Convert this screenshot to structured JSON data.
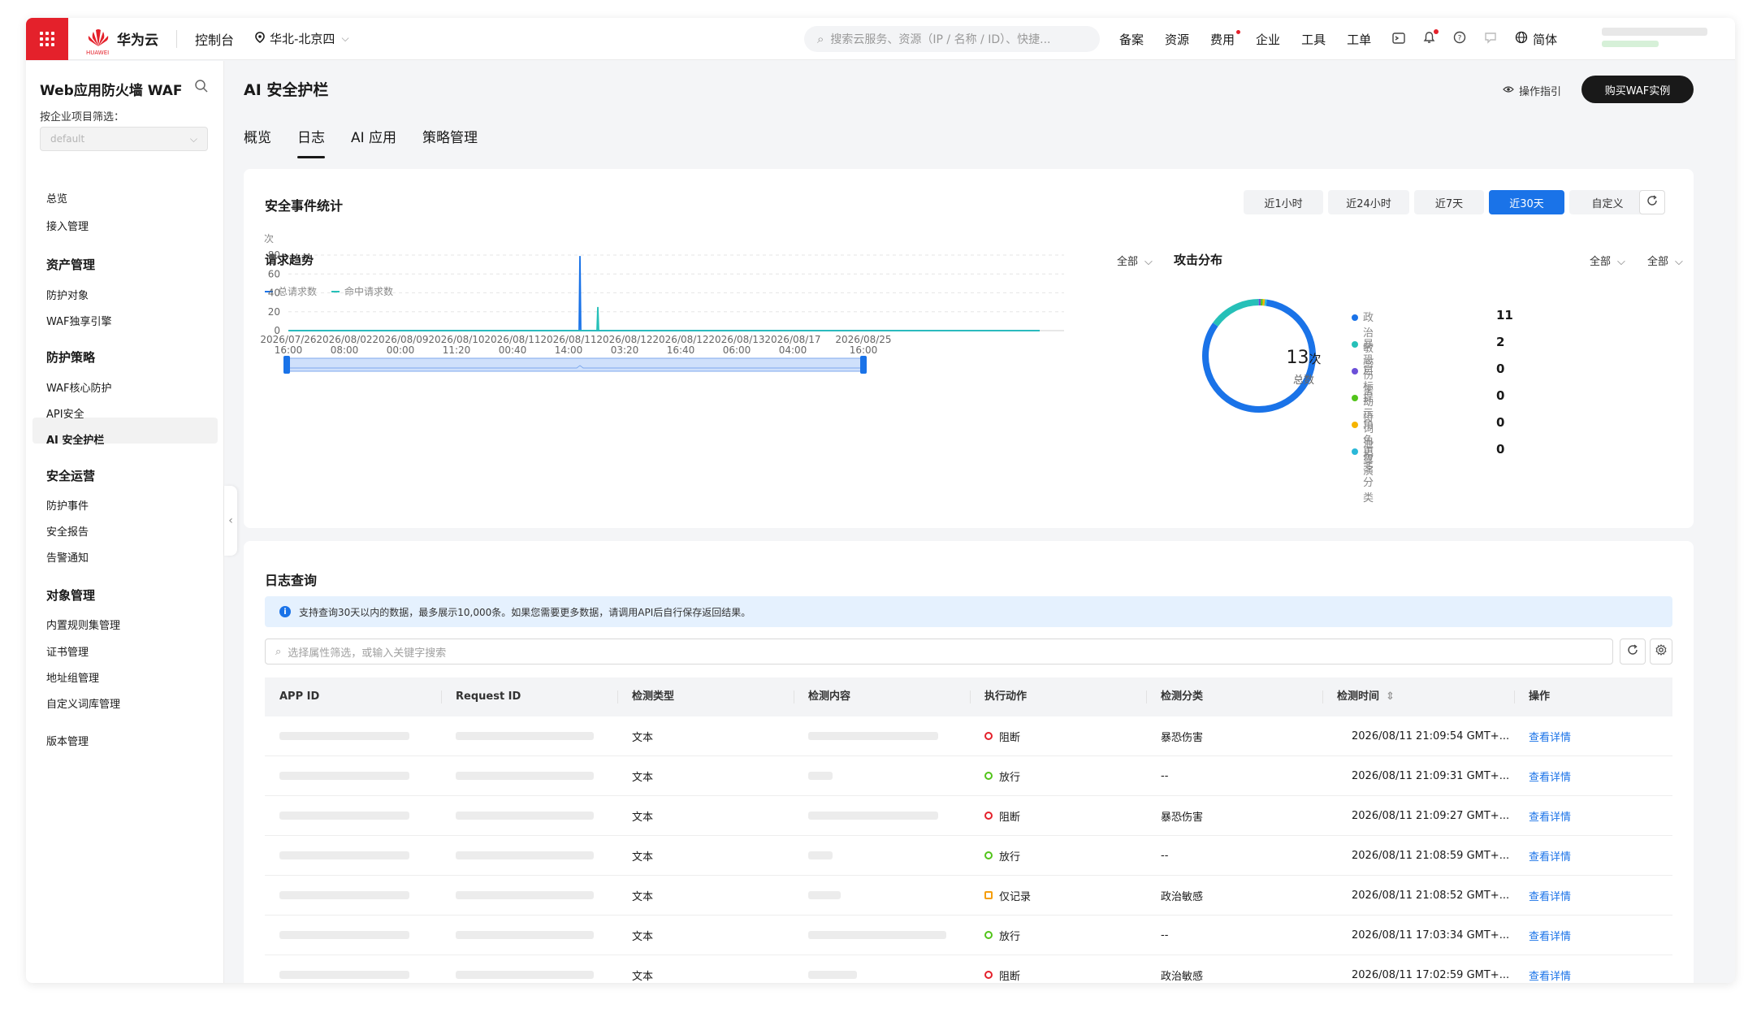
{
  "topbar": {
    "brand": "华为云",
    "brand_sub": "HUAWEI",
    "console": "控制台",
    "region": "华北-北京四",
    "search_placeholder": "搜索云服务、资源（IP / 名称 / ID）、快捷...",
    "links": [
      "备案",
      "资源",
      "费用",
      "企业",
      "工具",
      "工单"
    ],
    "lang": "简体"
  },
  "sidebar": {
    "title": "Web应用防火墙 WAF",
    "filter_label": "按企业项目筛选：",
    "filter_value": "default",
    "items": [
      {
        "label": "总览",
        "type": "item"
      },
      {
        "label": "接入管理",
        "type": "item"
      },
      {
        "label": "资产管理",
        "type": "group"
      },
      {
        "label": "防护对象",
        "type": "item"
      },
      {
        "label": "WAF独享引擎",
        "type": "item"
      },
      {
        "label": "防护策略",
        "type": "group"
      },
      {
        "label": "WAF核心防护",
        "type": "item"
      },
      {
        "label": "API安全",
        "type": "item"
      },
      {
        "label": "AI 安全护栏",
        "type": "item",
        "active": true
      },
      {
        "label": "安全运营",
        "type": "group"
      },
      {
        "label": "防护事件",
        "type": "item"
      },
      {
        "label": "安全报告",
        "type": "item"
      },
      {
        "label": "告警通知",
        "type": "item"
      },
      {
        "label": "对象管理",
        "type": "group"
      },
      {
        "label": "内置规则集管理",
        "type": "item"
      },
      {
        "label": "证书管理",
        "type": "item"
      },
      {
        "label": "地址组管理",
        "type": "item"
      },
      {
        "label": "自定义词库管理",
        "type": "item"
      },
      {
        "label": "版本管理",
        "type": "item"
      }
    ]
  },
  "page": {
    "title": "AI 安全护栏",
    "guide": "操作指引",
    "buy_button": "购买WAF实例",
    "tabs": [
      "概览",
      "日志",
      "AI 应用",
      "策略管理"
    ],
    "active_tab": 1
  },
  "stats": {
    "title": "安全事件统计",
    "time_ranges": [
      "近1小时",
      "近24小时",
      "近7天",
      "近30天",
      "自定义"
    ],
    "active_range": 3,
    "trend_title": "请求趋势",
    "trend_filter": "全部",
    "attack_title": "攻击分布",
    "attack_filter_1": "全部",
    "attack_filter_2": "全部",
    "legend": [
      {
        "name": "总请求数",
        "color": "#1a73e8"
      },
      {
        "name": "命中请求数",
        "color": "#26c0b8"
      }
    ],
    "donut_center_value": "13",
    "donut_center_unit": "次",
    "donut_center_label": "总数",
    "categories": [
      {
        "name": "政治敏感",
        "value": "11",
        "color": "#1a73e8"
      },
      {
        "name": "暴恐伤害",
        "value": "2",
        "color": "#26c0b8"
      },
      {
        "name": "目标劫持",
        "value": "0",
        "color": "#6b4fd8"
      },
      {
        "name": "提示词泄露",
        "value": "0",
        "color": "#52c41a"
      },
      {
        "name": "角色扮演",
        "value": "0",
        "color": "#f5b400"
      },
      {
        "name": "更多分类",
        "value": "0",
        "color": "#2ab8d8"
      }
    ]
  },
  "chart_data": {
    "type": "line",
    "title": "请求趋势",
    "ylabel": "次",
    "ylim": [
      0,
      80
    ],
    "yticks": [
      0,
      20,
      40,
      60,
      80
    ],
    "x_tick_labels": [
      [
        "2026/07/26",
        "16:00"
      ],
      [
        "2026/08/02",
        "08:00"
      ],
      [
        "2026/08/09",
        "00:00"
      ],
      [
        "2026/08/10",
        "11:20"
      ],
      [
        "2026/08/11",
        "00:40"
      ],
      [
        "2026/08/11",
        "14:00"
      ],
      [
        "2026/08/12",
        "03:20"
      ],
      [
        "2026/08/12",
        "16:40"
      ],
      [
        "2026/08/13",
        "06:00"
      ],
      [
        "2026/08/17",
        "04:00"
      ],
      [
        "2026/08/25",
        "16:00"
      ]
    ],
    "series": [
      {
        "name": "总请求数",
        "values": [
          0,
          0,
          0,
          0,
          0,
          79,
          0,
          0,
          0,
          0,
          0
        ]
      },
      {
        "name": "命中请求数",
        "values": [
          0,
          0,
          0,
          0,
          0,
          25,
          0,
          0,
          0,
          0,
          0
        ]
      }
    ],
    "grid": true,
    "legend": "top-left"
  },
  "logs": {
    "title": "日志查询",
    "info": "支持查询30天以内的数据，最多展示10,000条。如果您需要更多数据，请调用API后自行保存返回结果。",
    "filter_placeholder": "选择属性筛选，或输入关键字搜索",
    "columns": [
      "APP ID",
      "Request ID",
      "检测类型",
      "检测内容",
      "执行动作",
      "检测分类",
      "检测时间",
      "操作"
    ],
    "rows": [
      {
        "type": "文本",
        "action": "阻断",
        "action_kind": "block",
        "category": "暴恐伤害",
        "time": "2026/08/11 21:09:54 GMT+...",
        "op": "查看详情"
      },
      {
        "type": "文本",
        "action": "放行",
        "action_kind": "allow",
        "category": "--",
        "time": "2026/08/11 21:09:31 GMT+...",
        "op": "查看详情"
      },
      {
        "type": "文本",
        "action": "阻断",
        "action_kind": "block",
        "category": "暴恐伤害",
        "time": "2026/08/11 21:09:27 GMT+...",
        "op": "查看详情"
      },
      {
        "type": "文本",
        "action": "放行",
        "action_kind": "allow",
        "category": "--",
        "time": "2026/08/11 21:08:59 GMT+...",
        "op": "查看详情"
      },
      {
        "type": "文本",
        "action": "仅记录",
        "action_kind": "log",
        "category": "政治敏感",
        "time": "2026/08/11 21:08:52 GMT+...",
        "op": "查看详情"
      },
      {
        "type": "文本",
        "action": "放行",
        "action_kind": "allow",
        "category": "--",
        "time": "2026/08/11 17:03:34 GMT+...",
        "op": "查看详情"
      },
      {
        "type": "文本",
        "action": "阻断",
        "action_kind": "block",
        "category": "政治敏感",
        "time": "2026/08/11 17:02:59 GMT+...",
        "op": "查看详情"
      }
    ]
  },
  "colors": {
    "accent": "#1a73e8",
    "brand": "#e4212b",
    "block": "#e4212b",
    "allow": "#52c41a",
    "log": "#f59e0b"
  },
  "icons": [
    "menu-grid-icon",
    "huawei-logo-icon",
    "location-pin-icon",
    "search-icon",
    "terminal-icon",
    "bell-icon",
    "help-icon",
    "message-icon",
    "globe-icon",
    "eye-icon",
    "refresh-icon",
    "settings-icon",
    "info-icon",
    "sort-icon",
    "headset-icon",
    "chevron-right-icon",
    "smile-icon"
  ]
}
